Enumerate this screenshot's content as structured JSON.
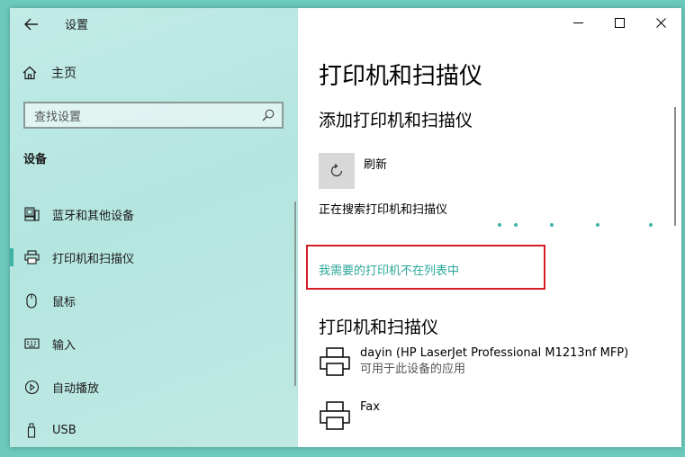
{
  "window": {
    "app_title": "设置"
  },
  "sidebar": {
    "home_label": "主页",
    "search_placeholder": "查找设置",
    "section_heading": "设备",
    "items": [
      {
        "label": "蓝牙和其他设备",
        "icon": "bluetooth-devices-icon",
        "selected": false
      },
      {
        "label": "打印机和扫描仪",
        "icon": "printer-icon",
        "selected": true
      },
      {
        "label": "鼠标",
        "icon": "mouse-icon",
        "selected": false
      },
      {
        "label": "输入",
        "icon": "keyboard-icon",
        "selected": false
      },
      {
        "label": "自动播放",
        "icon": "autoplay-icon",
        "selected": false
      },
      {
        "label": "USB",
        "icon": "usb-icon",
        "selected": false
      }
    ]
  },
  "main": {
    "title": "打印机和扫描仪",
    "add_section_title": "添加打印机和扫描仪",
    "refresh_label": "刷新",
    "searching_text": "正在搜索打印机和扫描仪",
    "not_listed_link": "我需要的打印机不在列表中",
    "printers_section_title": "打印机和扫描仪",
    "printers": [
      {
        "name": "dayin (HP LaserJet Professional M1213nf MFP)",
        "status": "可用于此设备的应用"
      },
      {
        "name": "Fax",
        "status": ""
      }
    ]
  },
  "colors": {
    "accent": "#3db3a7",
    "link": "#2aa79a",
    "highlight_border": "#d61d27",
    "desktop": "#6cc9bd"
  }
}
